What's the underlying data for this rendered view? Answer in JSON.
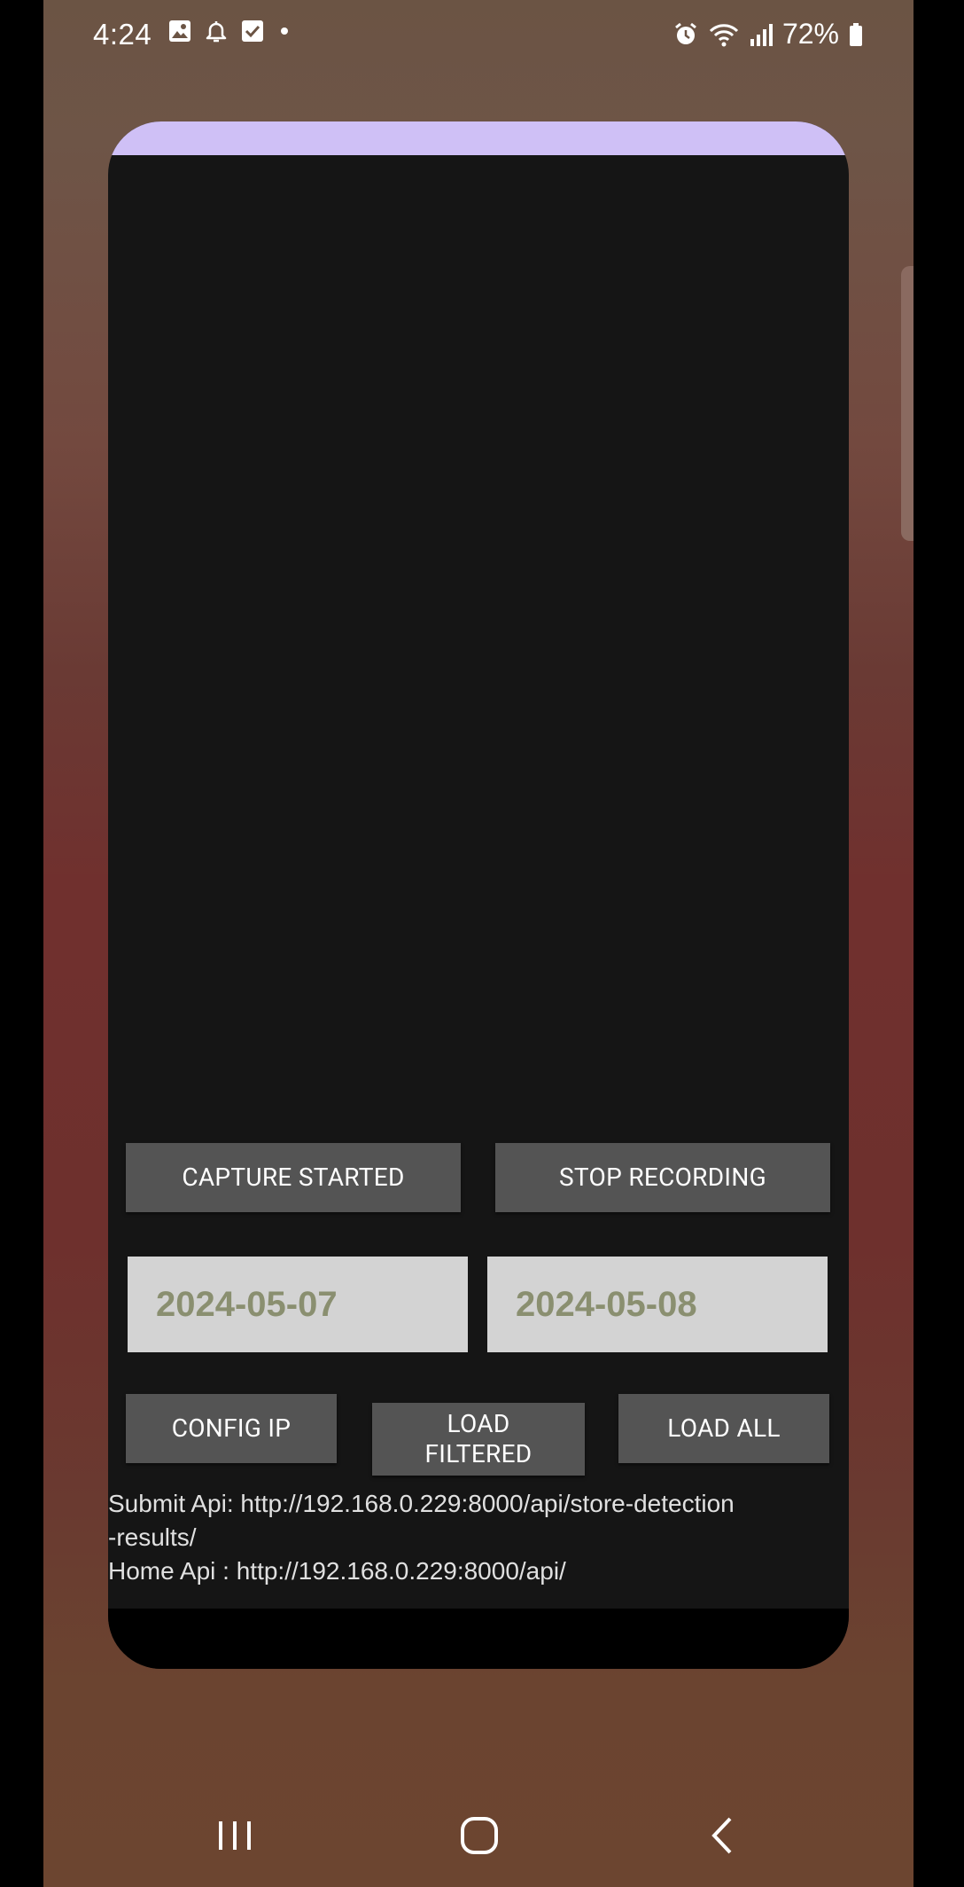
{
  "status_bar": {
    "time": "4:24",
    "battery": "72%",
    "left_icons": [
      "image-icon",
      "bell-alert-icon",
      "checkbox-icon",
      "dot-icon"
    ],
    "right_icons": [
      "alarm-icon",
      "wifi-icon",
      "signal-icon",
      "battery-icon"
    ]
  },
  "dialog": {
    "accent_color": "#cfc0f6",
    "buttons": {
      "capture": "CAPTURE STARTED",
      "stop": "STOP RECORDING",
      "config_ip": "CONFIG IP",
      "load_filtered": "LOAD FILTERED",
      "load_all": "LOAD ALL"
    },
    "dates": {
      "start": "2024-05-07",
      "end": "2024-05-08"
    },
    "api": {
      "submit_line1": "Submit Api: http://192.168.0.229:8000/api/store-detection",
      "submit_line2": "-results/",
      "home": "Home Api : http://192.168.0.229:8000/api/"
    }
  },
  "nav_bar": {
    "items": [
      "recent-apps-icon",
      "home-icon",
      "back-icon"
    ]
  }
}
